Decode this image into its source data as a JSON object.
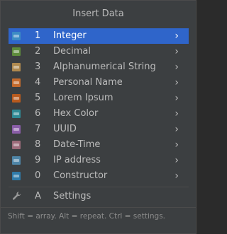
{
  "popup": {
    "title": "Insert Data",
    "items": [
      {
        "key": "1",
        "label": "Integer",
        "icon": "integer-icon",
        "color": "#3c8bc4",
        "selected": true
      },
      {
        "key": "2",
        "label": "Decimal",
        "icon": "decimal-icon",
        "color": "#5e8c3c"
      },
      {
        "key": "3",
        "label": "Alphanumerical String",
        "icon": "string-icon",
        "color": "#b08a4f"
      },
      {
        "key": "4",
        "label": "Personal Name",
        "icon": "name-icon",
        "color": "#c36a2d"
      },
      {
        "key": "5",
        "label": "Lorem Ipsum",
        "icon": "lorem-icon",
        "color": "#b85a1e"
      },
      {
        "key": "6",
        "label": "Hex Color",
        "icon": "hex-color-icon",
        "color": "#2f8a95"
      },
      {
        "key": "7",
        "label": "UUID",
        "icon": "uuid-icon",
        "color": "#8a5ea8"
      },
      {
        "key": "8",
        "label": "Date-Time",
        "icon": "datetime-icon",
        "color": "#9c6b7a"
      },
      {
        "key": "9",
        "label": "IP address",
        "icon": "ip-icon",
        "color": "#4f86a8"
      },
      {
        "key": "0",
        "label": "Constructor",
        "icon": "constructor-icon",
        "color": "#2f7aa8"
      }
    ],
    "settings": {
      "key": "A",
      "label": "Settings",
      "icon": "wrench-icon"
    },
    "footer": "Shift = array. Alt = repeat. Ctrl = settings.",
    "chevron": "›"
  }
}
